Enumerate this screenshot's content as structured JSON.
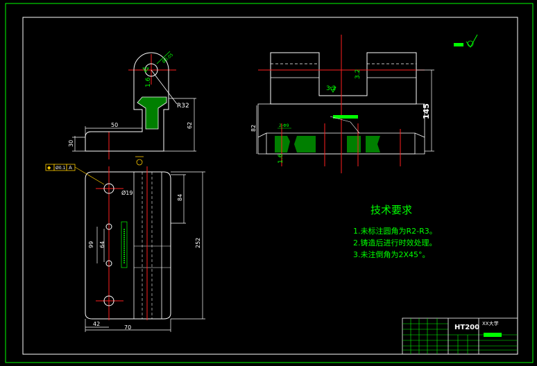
{
  "colors": {
    "background": "#000000",
    "border": "#00ff00",
    "geometry": "#ffffff",
    "centerline": "#ff2020",
    "dimension": "#ffffff",
    "hatch": "#00cc00",
    "text_green": "#00ff00",
    "roughness": "#00ff00"
  },
  "dimensions": {
    "d50": "50",
    "d62": "62",
    "d30": "30",
    "r32": "R32",
    "d145": "145",
    "d82": "82",
    "d84": "84",
    "d252": "252",
    "d99": "99",
    "d64": "64",
    "d42": "42",
    "d70": "70",
    "phi19": "Ø19"
  },
  "roughness": {
    "r16_left": "1.6",
    "r32_a": "3.2",
    "r32_b": "3.2",
    "r16_b": "1.6"
  },
  "tolerance_frame": {
    "symbol": "◆",
    "value": "Ø0.1",
    "datum": "A"
  },
  "notes": {
    "title": "技术要求",
    "items": [
      "1.未标注圆角为R2-R3。",
      "2.铸造后进行时效处理。",
      "3.未注倒角为2X45°。"
    ]
  },
  "title_block": {
    "material": "HT200",
    "org": "XX大学"
  }
}
